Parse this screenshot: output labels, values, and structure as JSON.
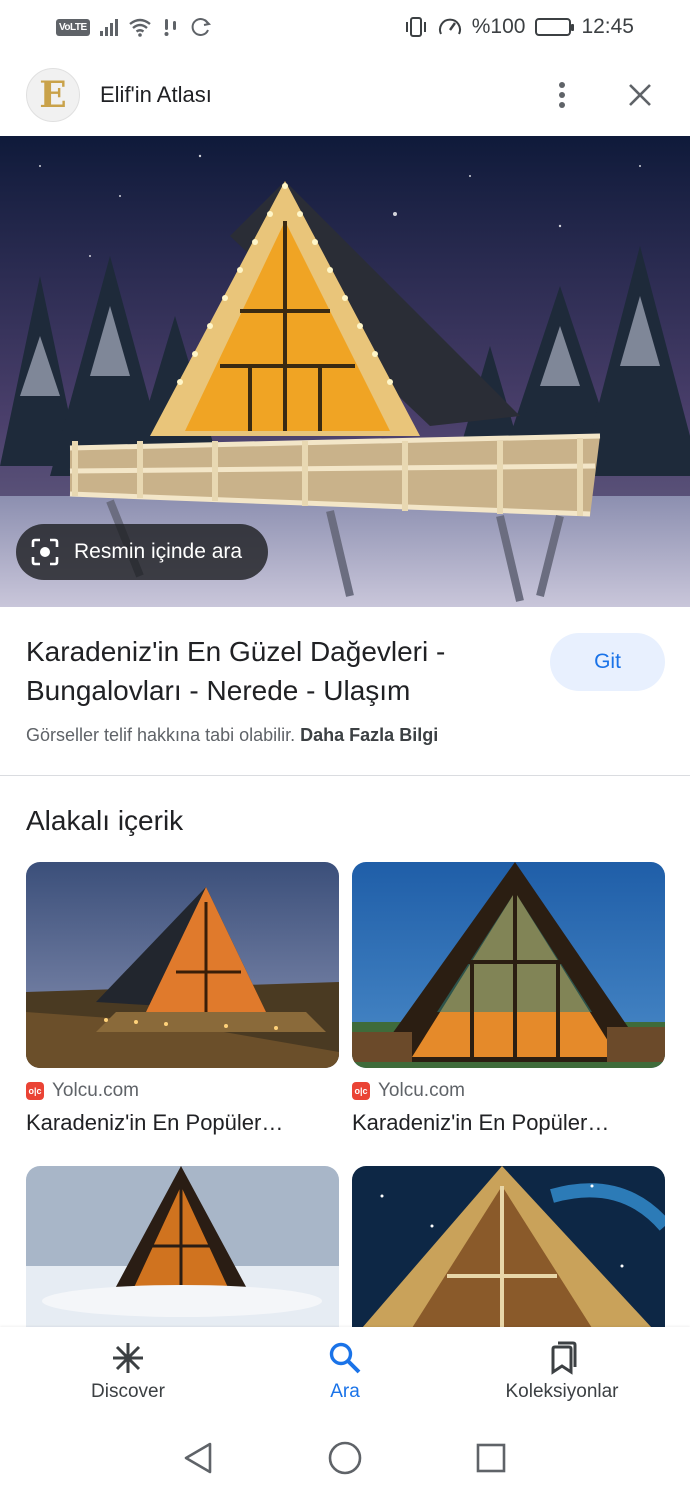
{
  "status_bar": {
    "volte": "VoLTE",
    "battery": "%100",
    "time": "12:45"
  },
  "header": {
    "avatar_letter": "E",
    "title": "Elif'in Atlası"
  },
  "hero": {
    "lens_label": "Resmin içinde ara"
  },
  "result": {
    "title": "Karadeniz'in En Güzel Dağevleri - Bungalovları - Nerede - Ulaşım",
    "visit_label": "Git",
    "copyright_text": "Görseller telif hakkına tabi olabilir.",
    "more_info": "Daha Fazla Bilgi"
  },
  "related": {
    "heading": "Alakalı içerik",
    "items": [
      {
        "source": "Yolcu.com",
        "title": "Karadeniz'in En Popüler…"
      },
      {
        "source": "Yolcu.com",
        "title": "Karadeniz'in En Popüler…"
      }
    ]
  },
  "bottom_nav": {
    "items": [
      {
        "label": "Discover",
        "icon": "asterisk-icon"
      },
      {
        "label": "Ara",
        "icon": "search-icon"
      },
      {
        "label": "Koleksiyonlar",
        "icon": "bookmarks-icon"
      }
    ]
  },
  "colors": {
    "accent": "#1a73e8",
    "chip_bg": "#e8f0fe",
    "favicon": "#ea4335"
  }
}
